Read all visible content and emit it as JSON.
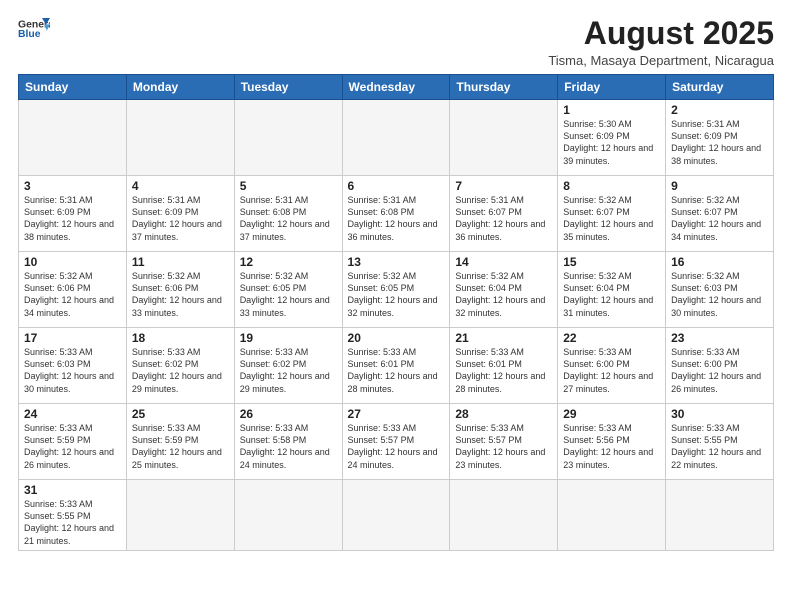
{
  "header": {
    "logo_general": "General",
    "logo_blue": "Blue",
    "month_title": "August 2025",
    "location": "Tisma, Masaya Department, Nicaragua"
  },
  "days_of_week": [
    "Sunday",
    "Monday",
    "Tuesday",
    "Wednesday",
    "Thursday",
    "Friday",
    "Saturday"
  ],
  "weeks": [
    [
      {
        "day": "",
        "info": ""
      },
      {
        "day": "",
        "info": ""
      },
      {
        "day": "",
        "info": ""
      },
      {
        "day": "",
        "info": ""
      },
      {
        "day": "",
        "info": ""
      },
      {
        "day": "1",
        "info": "Sunrise: 5:30 AM\nSunset: 6:09 PM\nDaylight: 12 hours and 39 minutes."
      },
      {
        "day": "2",
        "info": "Sunrise: 5:31 AM\nSunset: 6:09 PM\nDaylight: 12 hours and 38 minutes."
      }
    ],
    [
      {
        "day": "3",
        "info": "Sunrise: 5:31 AM\nSunset: 6:09 PM\nDaylight: 12 hours and 38 minutes."
      },
      {
        "day": "4",
        "info": "Sunrise: 5:31 AM\nSunset: 6:09 PM\nDaylight: 12 hours and 37 minutes."
      },
      {
        "day": "5",
        "info": "Sunrise: 5:31 AM\nSunset: 6:08 PM\nDaylight: 12 hours and 37 minutes."
      },
      {
        "day": "6",
        "info": "Sunrise: 5:31 AM\nSunset: 6:08 PM\nDaylight: 12 hours and 36 minutes."
      },
      {
        "day": "7",
        "info": "Sunrise: 5:31 AM\nSunset: 6:07 PM\nDaylight: 12 hours and 36 minutes."
      },
      {
        "day": "8",
        "info": "Sunrise: 5:32 AM\nSunset: 6:07 PM\nDaylight: 12 hours and 35 minutes."
      },
      {
        "day": "9",
        "info": "Sunrise: 5:32 AM\nSunset: 6:07 PM\nDaylight: 12 hours and 34 minutes."
      }
    ],
    [
      {
        "day": "10",
        "info": "Sunrise: 5:32 AM\nSunset: 6:06 PM\nDaylight: 12 hours and 34 minutes."
      },
      {
        "day": "11",
        "info": "Sunrise: 5:32 AM\nSunset: 6:06 PM\nDaylight: 12 hours and 33 minutes."
      },
      {
        "day": "12",
        "info": "Sunrise: 5:32 AM\nSunset: 6:05 PM\nDaylight: 12 hours and 33 minutes."
      },
      {
        "day": "13",
        "info": "Sunrise: 5:32 AM\nSunset: 6:05 PM\nDaylight: 12 hours and 32 minutes."
      },
      {
        "day": "14",
        "info": "Sunrise: 5:32 AM\nSunset: 6:04 PM\nDaylight: 12 hours and 32 minutes."
      },
      {
        "day": "15",
        "info": "Sunrise: 5:32 AM\nSunset: 6:04 PM\nDaylight: 12 hours and 31 minutes."
      },
      {
        "day": "16",
        "info": "Sunrise: 5:32 AM\nSunset: 6:03 PM\nDaylight: 12 hours and 30 minutes."
      }
    ],
    [
      {
        "day": "17",
        "info": "Sunrise: 5:33 AM\nSunset: 6:03 PM\nDaylight: 12 hours and 30 minutes."
      },
      {
        "day": "18",
        "info": "Sunrise: 5:33 AM\nSunset: 6:02 PM\nDaylight: 12 hours and 29 minutes."
      },
      {
        "day": "19",
        "info": "Sunrise: 5:33 AM\nSunset: 6:02 PM\nDaylight: 12 hours and 29 minutes."
      },
      {
        "day": "20",
        "info": "Sunrise: 5:33 AM\nSunset: 6:01 PM\nDaylight: 12 hours and 28 minutes."
      },
      {
        "day": "21",
        "info": "Sunrise: 5:33 AM\nSunset: 6:01 PM\nDaylight: 12 hours and 28 minutes."
      },
      {
        "day": "22",
        "info": "Sunrise: 5:33 AM\nSunset: 6:00 PM\nDaylight: 12 hours and 27 minutes."
      },
      {
        "day": "23",
        "info": "Sunrise: 5:33 AM\nSunset: 6:00 PM\nDaylight: 12 hours and 26 minutes."
      }
    ],
    [
      {
        "day": "24",
        "info": "Sunrise: 5:33 AM\nSunset: 5:59 PM\nDaylight: 12 hours and 26 minutes."
      },
      {
        "day": "25",
        "info": "Sunrise: 5:33 AM\nSunset: 5:59 PM\nDaylight: 12 hours and 25 minutes."
      },
      {
        "day": "26",
        "info": "Sunrise: 5:33 AM\nSunset: 5:58 PM\nDaylight: 12 hours and 24 minutes."
      },
      {
        "day": "27",
        "info": "Sunrise: 5:33 AM\nSunset: 5:57 PM\nDaylight: 12 hours and 24 minutes."
      },
      {
        "day": "28",
        "info": "Sunrise: 5:33 AM\nSunset: 5:57 PM\nDaylight: 12 hours and 23 minutes."
      },
      {
        "day": "29",
        "info": "Sunrise: 5:33 AM\nSunset: 5:56 PM\nDaylight: 12 hours and 23 minutes."
      },
      {
        "day": "30",
        "info": "Sunrise: 5:33 AM\nSunset: 5:55 PM\nDaylight: 12 hours and 22 minutes."
      }
    ],
    [
      {
        "day": "31",
        "info": "Sunrise: 5:33 AM\nSunset: 5:55 PM\nDaylight: 12 hours and 21 minutes."
      },
      {
        "day": "",
        "info": ""
      },
      {
        "day": "",
        "info": ""
      },
      {
        "day": "",
        "info": ""
      },
      {
        "day": "",
        "info": ""
      },
      {
        "day": "",
        "info": ""
      },
      {
        "day": "",
        "info": ""
      }
    ]
  ]
}
